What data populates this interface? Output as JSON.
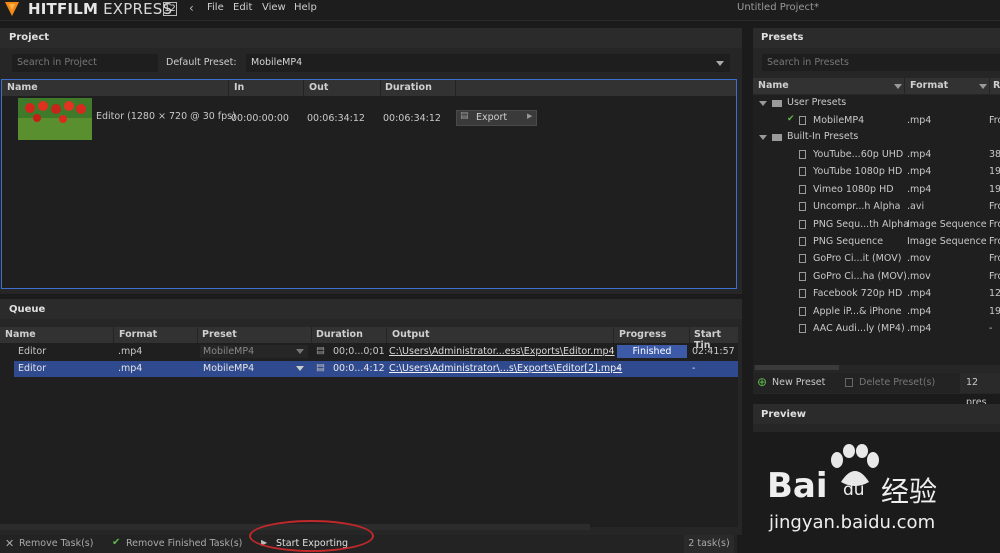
{
  "app": {
    "brand_bold": "HITFILM",
    "brand_light": "EXPRESS",
    "version": "12",
    "project_title": "Untitled Project*",
    "menus": [
      "File",
      "Edit",
      "View",
      "Help"
    ]
  },
  "project": {
    "tab": "Project",
    "search_placeholder": "Search in Project",
    "default_preset_label": "Default Preset:",
    "default_preset_value": "MobileMP4",
    "columns": [
      "Name",
      "In",
      "Out",
      "Duration"
    ],
    "item": {
      "name": "Editor (1280 × 720 @ 30 fps)",
      "in": "00:00:00:00",
      "out": "00:06:34:12",
      "duration": "00:06:34:12",
      "export_label": "Export"
    }
  },
  "queue": {
    "tab": "Queue",
    "columns": [
      "Name",
      "Format",
      "Preset",
      "Duration",
      "Output",
      "Progress",
      "Start Tin"
    ],
    "rows": [
      {
        "name": "Editor",
        "format": ".mp4",
        "preset": "MobileMP4",
        "duration": "00;0...0;01",
        "output": "C:\\Users\\Administrator...ess\\Exports\\Editor.mp4",
        "progress": "Finished",
        "start": "02:41:57"
      },
      {
        "name": "Editor",
        "format": ".mp4",
        "preset": "MobileMP4",
        "duration": "00:0...4:12",
        "output": "C:\\Users\\Administrator\\...s\\Exports\\Editor[2].mp4",
        "progress": "-",
        "start": "-"
      }
    ],
    "remove_tasks": "Remove Task(s)",
    "remove_finished": "Remove Finished Task(s)",
    "start_exporting": "Start Exporting",
    "task_count": "2 task(s)"
  },
  "presets": {
    "tab": "Presets",
    "search_placeholder": "Search in Presets",
    "columns": [
      "Name",
      "Format",
      "R"
    ],
    "user_group": "User Presets",
    "builtin_group": "Built-In Presets",
    "user_items": [
      {
        "name": "MobileMP4",
        "format": ".mp4",
        "r": "Fro"
      }
    ],
    "builtin_items": [
      {
        "name": "YouTube...60p UHD",
        "format": ".mp4",
        "r": "38"
      },
      {
        "name": "YouTube 1080p HD",
        "format": ".mp4",
        "r": "19"
      },
      {
        "name": "Vimeo 1080p HD",
        "format": ".mp4",
        "r": "19"
      },
      {
        "name": "Uncompr...h Alpha",
        "format": ".avi",
        "r": "Fro"
      },
      {
        "name": "PNG Sequ...th Alpha",
        "format": "Image Sequence",
        "r": "Fro"
      },
      {
        "name": "PNG Sequence",
        "format": "Image Sequence",
        "r": "Fro"
      },
      {
        "name": "GoPro Ci...it (MOV)",
        "format": ".mov",
        "r": "Fro"
      },
      {
        "name": "GoPro Ci...ha (MOV)",
        "format": ".mov",
        "r": "Fro"
      },
      {
        "name": "Facebook 720p HD",
        "format": ".mp4",
        "r": "12"
      },
      {
        "name": "Apple iP...& iPhone",
        "format": ".mp4",
        "r": "19"
      },
      {
        "name": "AAC Audi...ly (MP4)",
        "format": ".mp4",
        "r": "-"
      }
    ],
    "new_preset": "New Preset",
    "delete_preset": "Delete Preset(s)",
    "preset_count": "12 pres"
  },
  "preview": {
    "tab": "Preview",
    "watermark_main": "Bai",
    "watermark_du": "du",
    "watermark_cn": "经验",
    "watermark_url": "jingyan.baidu.com"
  },
  "colors": {
    "accent_blue": "#3c5aa8",
    "selection": "#2f4a8f",
    "logo_orange": "#f08a18",
    "annotation_red": "#c0282b"
  }
}
